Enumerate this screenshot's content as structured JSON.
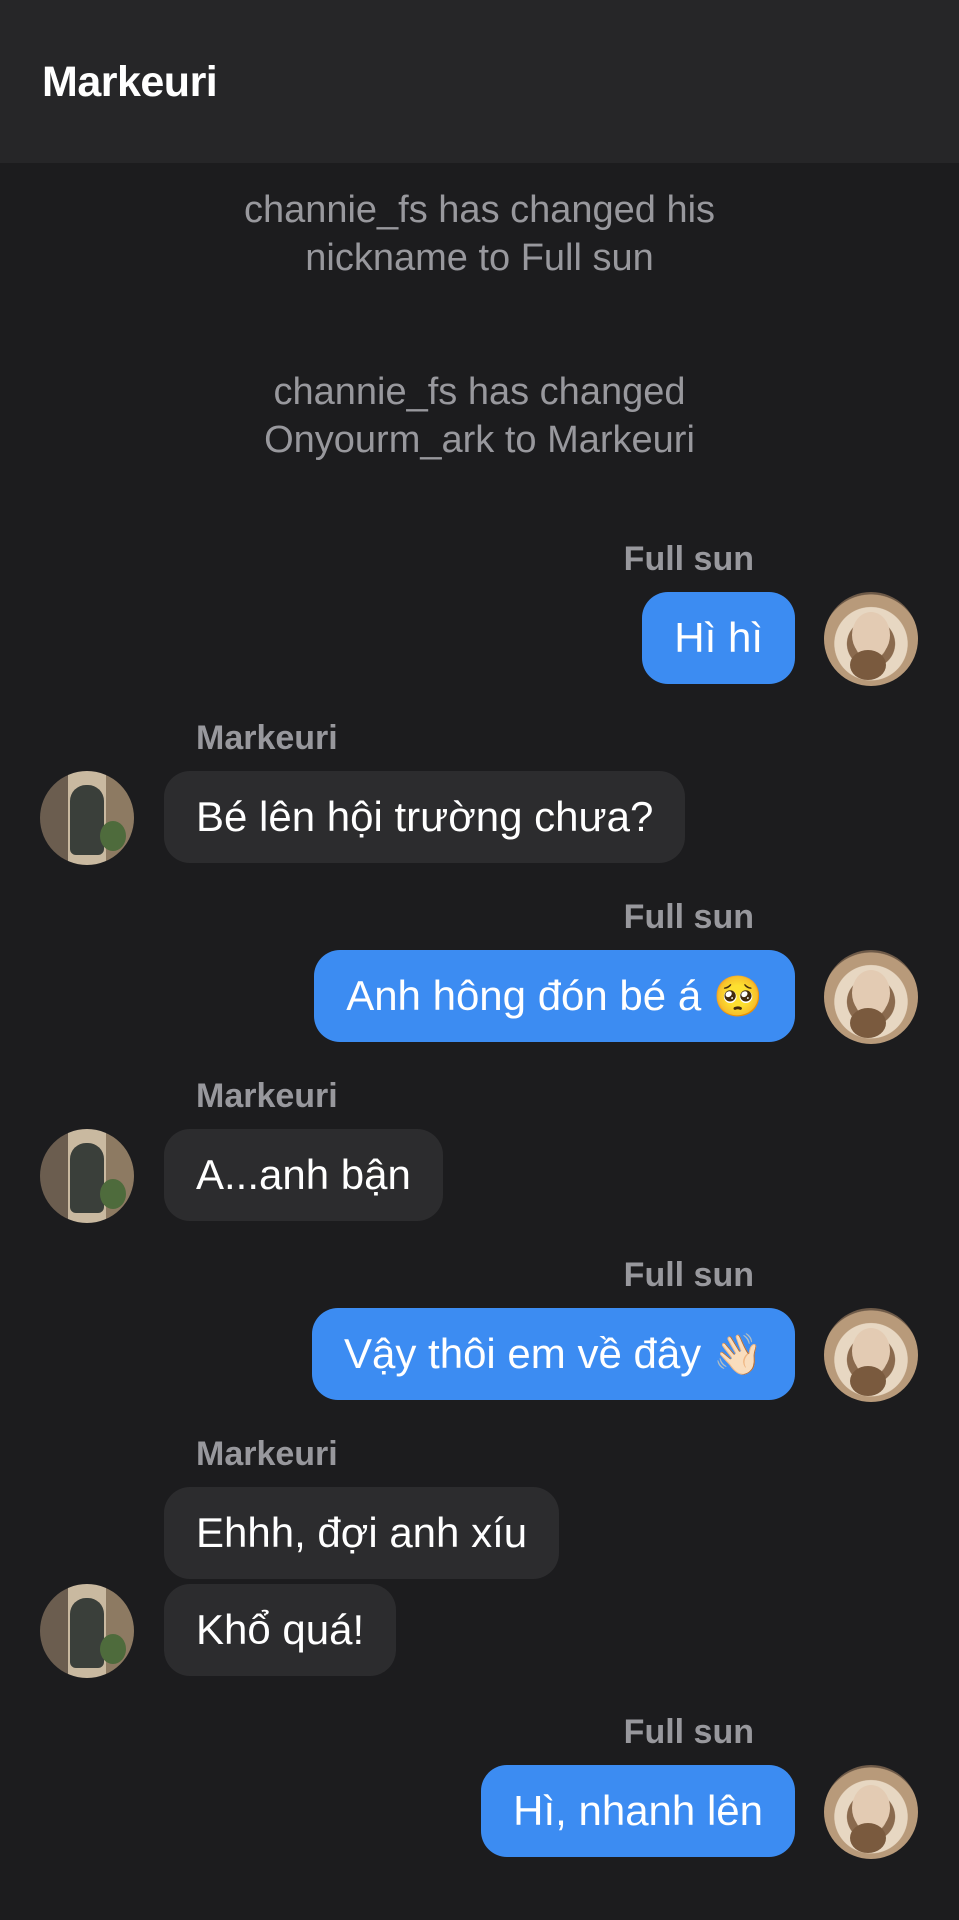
{
  "header": {
    "title": "Markeuri"
  },
  "system_messages": [
    {
      "line1": "channie_fs has changed his",
      "line2": "nickname to Full sun"
    },
    {
      "line1": "channie_fs has changed",
      "line2": "Onyourm_ark to Markeuri"
    }
  ],
  "messages": [
    {
      "sender": "Full sun",
      "text": "Hì hì",
      "direction": "outgoing"
    },
    {
      "sender": "Markeuri",
      "text": "Bé lên hội trường chưa?",
      "direction": "incoming"
    },
    {
      "sender": "Full sun",
      "text": "Anh hông đón bé á",
      "emoji": "🥺",
      "direction": "outgoing"
    },
    {
      "sender": "Markeuri",
      "text": "A...anh bận",
      "direction": "incoming"
    },
    {
      "sender": "Full sun",
      "text": "Vậy thôi em về đây",
      "emoji": "👋🏻",
      "direction": "outgoing"
    },
    {
      "sender": "Markeuri",
      "text": "Ehhh, đợi anh xíu",
      "direction": "incoming"
    },
    {
      "text": "Khổ quá!",
      "direction": "incoming"
    },
    {
      "sender": "Full sun",
      "text": "Hì, nhanh lên",
      "direction": "outgoing"
    }
  ],
  "colors": {
    "background": "#1c1c1e",
    "header": "#262628",
    "outgoing_bubble": "#3c8cf2",
    "incoming_bubble": "#2c2c2e",
    "meta_text": "#98989d"
  },
  "icons": {
    "my_avatar": "user-avatar-icon",
    "their_avatar": "contact-avatar-icon"
  }
}
